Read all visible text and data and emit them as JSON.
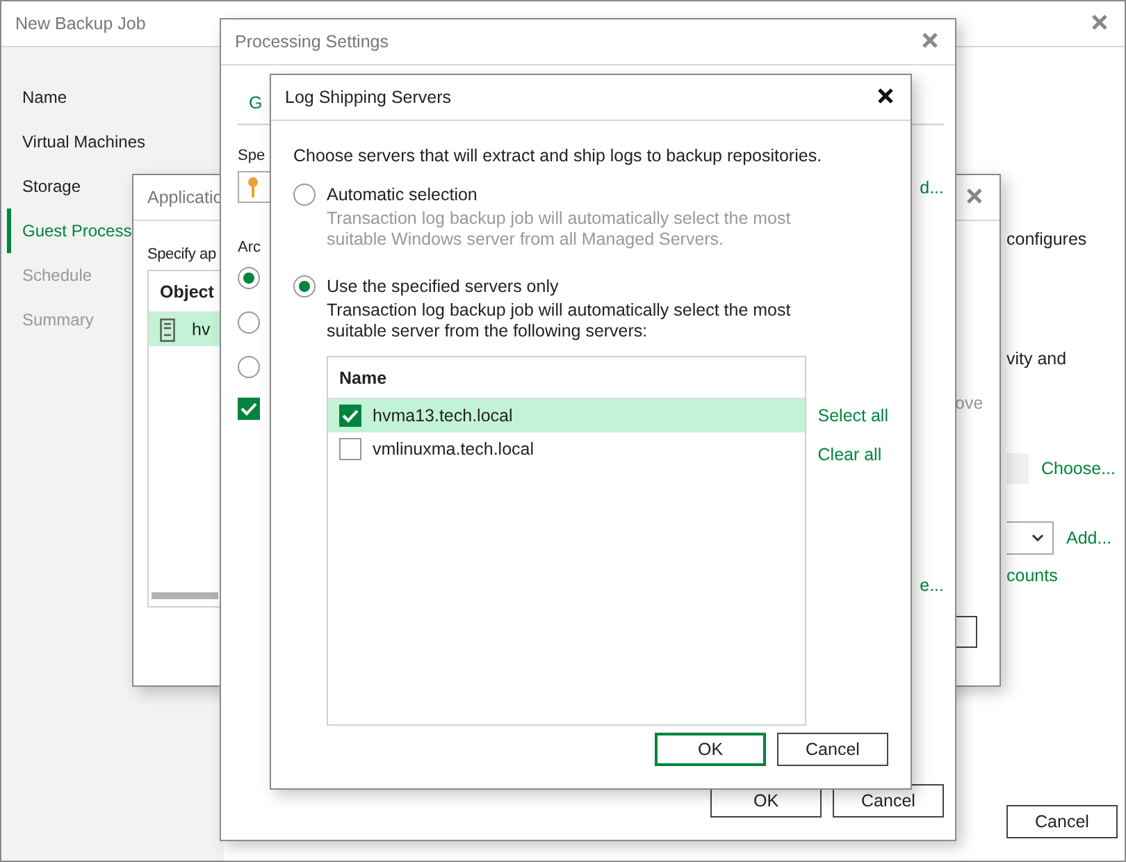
{
  "main_window": {
    "title": "New Backup Job",
    "steps": [
      {
        "label": "Name",
        "selected": false,
        "disabled": false
      },
      {
        "label": "Virtual Machines",
        "selected": false,
        "disabled": false
      },
      {
        "label": "Storage",
        "selected": false,
        "disabled": false
      },
      {
        "label": "Guest Process",
        "selected": true,
        "disabled": false
      },
      {
        "label": "Schedule",
        "selected": false,
        "disabled": true
      },
      {
        "label": "Summary",
        "selected": false,
        "disabled": true
      }
    ],
    "content": {
      "text_1": "configures",
      "text_2": "vity and",
      "choose_link": "Choose...",
      "add_link": "Add...",
      "accounts_link": "counts"
    },
    "buttons": [
      {
        "label": "Cancel"
      }
    ]
  },
  "application_window": {
    "title": "Applicatio",
    "instruction": "Specify ap",
    "hint": "ove",
    "table": {
      "columns": [
        "Object"
      ],
      "rows": [
        {
          "object": "hv",
          "selected": true
        }
      ]
    }
  },
  "processing_window": {
    "title": "Processing Settings",
    "tab": "G",
    "label_1": "Spe",
    "link_1": "d...",
    "label_2": "Arc",
    "radios": [
      {
        "selected": true
      },
      {
        "selected": false
      },
      {
        "selected": false
      }
    ],
    "checkbox": {
      "checked": true
    },
    "link_2": "e...",
    "buttons": [
      {
        "label": "OK"
      },
      {
        "label": "Cancel"
      }
    ]
  },
  "log_shipping_dialog": {
    "title": "Log Shipping Servers",
    "instruction": "Choose servers that will extract and ship logs to backup repositories.",
    "options": [
      {
        "label": "Automatic selection",
        "description": "Transaction log backup job will automatically select the most suitable Windows server from all Managed Servers.",
        "selected": false
      },
      {
        "label": "Use the specified servers only",
        "description": "Transaction log backup job will automatically select the most suitable server from the following servers:",
        "selected": true
      }
    ],
    "table": {
      "columns": [
        "Name"
      ],
      "rows": [
        {
          "name": "hvma13.tech.local",
          "checked": true,
          "selected": true
        },
        {
          "name": "vmlinuxma.tech.local",
          "checked": false,
          "selected": false
        }
      ]
    },
    "links": [
      "Select all",
      "Clear all"
    ],
    "buttons": [
      {
        "label": "OK",
        "default": true
      },
      {
        "label": "Cancel",
        "default": false
      }
    ]
  }
}
